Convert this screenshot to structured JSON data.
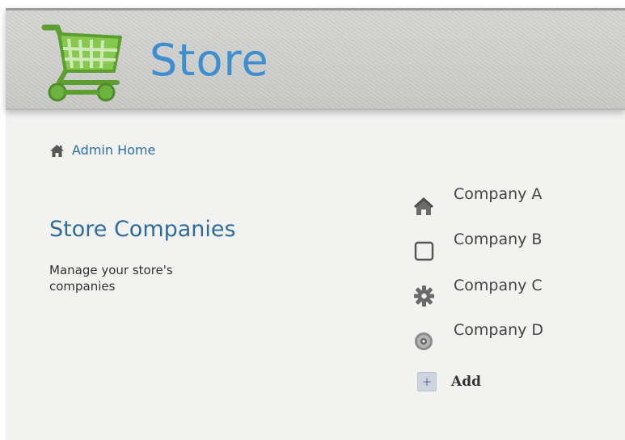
{
  "header": {
    "title": "Store"
  },
  "breadcrumb": {
    "label": "Admin Home"
  },
  "section": {
    "title": "Store Companies",
    "description": "Manage your store's companies"
  },
  "companies": [
    {
      "label": "Company A",
      "icon": "home-icon"
    },
    {
      "label": "Company B",
      "icon": "square-outline-icon"
    },
    {
      "label": "Company C",
      "icon": "gear-icon"
    },
    {
      "label": "Company D",
      "icon": "disc-icon"
    }
  ],
  "actions": {
    "add_label": "Add",
    "add_icon": "plus-icon"
  },
  "colors": {
    "title_blue": "#3d8fcf",
    "link_blue": "#2d6fa5",
    "heading_blue": "#2f6c99",
    "cart_green": "#7ac143"
  }
}
